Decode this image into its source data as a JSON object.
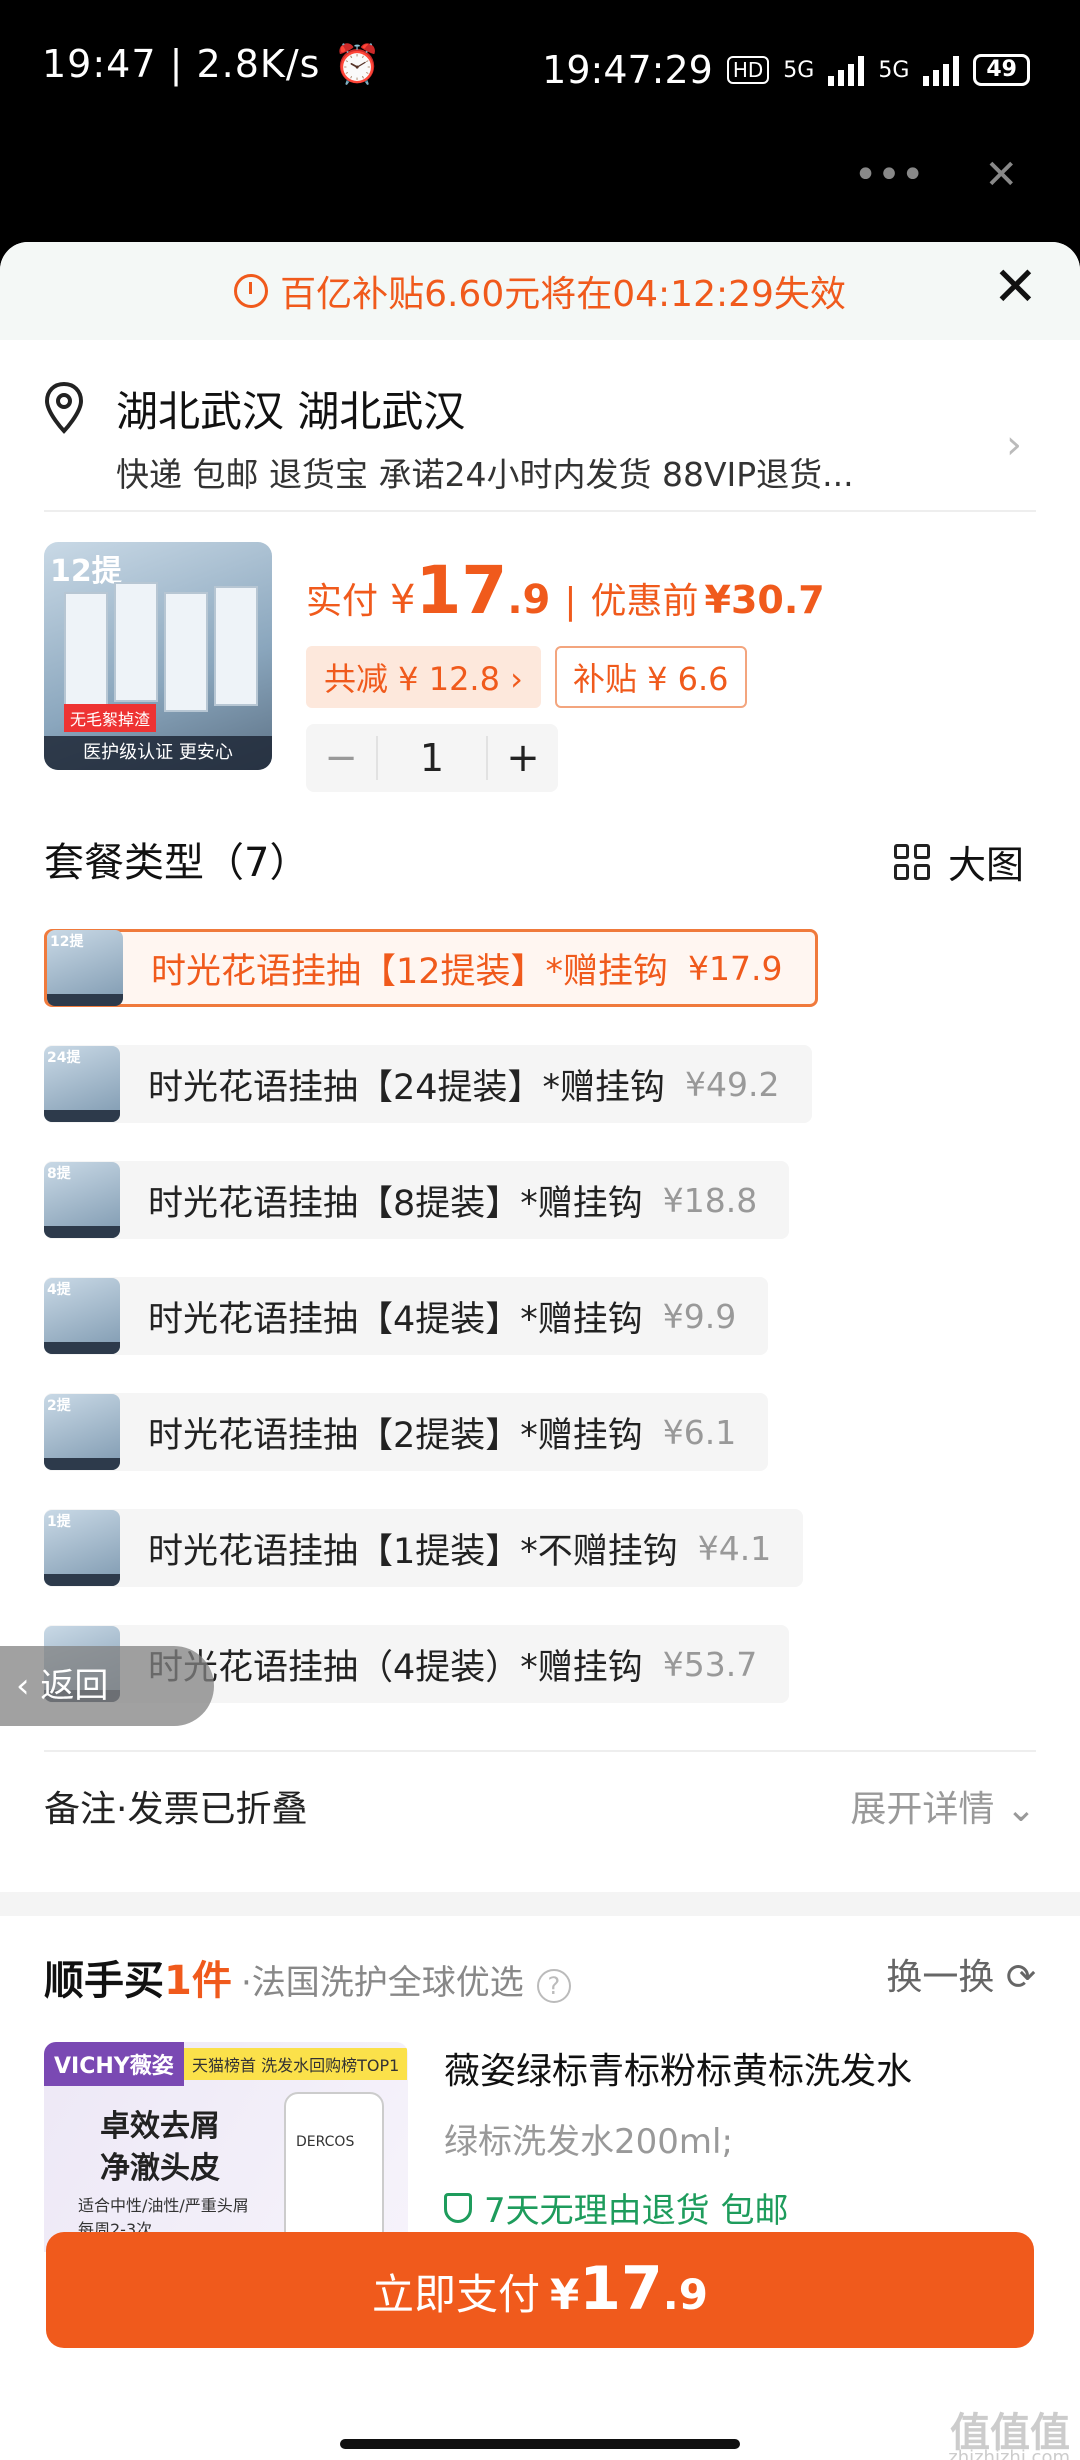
{
  "statusbar": {
    "left": "19:47 | 2.8K/s ⏰",
    "time": "19:47:29",
    "hd": "HD",
    "net1": "5G",
    "net2": "5G",
    "battery": "49"
  },
  "top_actions": {
    "more": "•••",
    "close": "✕"
  },
  "banner": {
    "text": "百亿补贴6.60元将在04:12:29失效",
    "close": "✕"
  },
  "address": {
    "city": "湖北武汉 湖北武汉",
    "services": "快递 包邮 退货宝 承诺24小时内发货 88VIP退货...",
    "chevron": "›"
  },
  "product": {
    "thumb_tag": "12提",
    "thumb_red": "无毛絮掉渣",
    "thumb_foot": "医护级认证 更安心",
    "pay_label": "实付",
    "currency": "¥",
    "price_int": "17",
    "price_dec": ".9",
    "separator": "|",
    "pre_label": "优惠前",
    "pre_price": "¥30.7",
    "discount": "共减 ¥ 12.8 ›",
    "subsidy": "补贴 ¥ 6.6",
    "minus": "−",
    "qty": "1",
    "plus": "+"
  },
  "packages": {
    "title": "套餐类型（7）",
    "view_label": "大图",
    "items": [
      {
        "tag": "12提",
        "name": "时光花语挂抽【12提装】*赠挂钩",
        "price": "¥17.9"
      },
      {
        "tag": "24提",
        "name": "时光花语挂抽【24提装】*赠挂钩",
        "price": "¥49.2"
      },
      {
        "tag": "8提",
        "name": "时光花语挂抽【8提装】*赠挂钩",
        "price": "¥18.8"
      },
      {
        "tag": "4提",
        "name": "时光花语挂抽【4提装】*赠挂钩",
        "price": "¥9.9"
      },
      {
        "tag": "2提",
        "name": "时光花语挂抽【2提装】*赠挂钩",
        "price": "¥6.1"
      },
      {
        "tag": "1提",
        "name": "时光花语挂抽【1提装】*不赠挂钩",
        "price": "¥4.1"
      },
      {
        "tag": "",
        "name": "时光花语挂抽（4提装）*赠挂钩",
        "price": "¥53.7"
      }
    ]
  },
  "back_label": "‹ 返回",
  "remark": {
    "label": "备注·发票已折叠",
    "expand": "展开详情 ⌄"
  },
  "recommend": {
    "brand_a": "顺手买",
    "brand_b": "1件",
    "subtitle": "·法国洗护全球优选",
    "qmark": "?",
    "swap": "换一换 ⟳",
    "img_tag": "VICHY薇姿",
    "img_yellow": "天猫榜首 洗发水回购榜TOP1",
    "img_headline": "卓效去屑\n净澈头皮",
    "img_sub": "适合中性/油性/严重头屑\n每周2-3次",
    "bottle_label": "DERCOS",
    "name": "薇姿绿标青标粉标黄标洗发水",
    "spec": "绿标洗发水200ml;",
    "guarantee": "7天无理由退货  包邮"
  },
  "pay_button": {
    "text": "立即支付",
    "currency": "¥",
    "int": "17",
    "dec": ".9"
  },
  "watermark": {
    "logo": "值值值",
    "site": "zhizhizhi.com"
  },
  "colors": {
    "accent": "#f05a1c",
    "green": "#1e9c5c",
    "banner_bg": "#f4f8f6"
  }
}
